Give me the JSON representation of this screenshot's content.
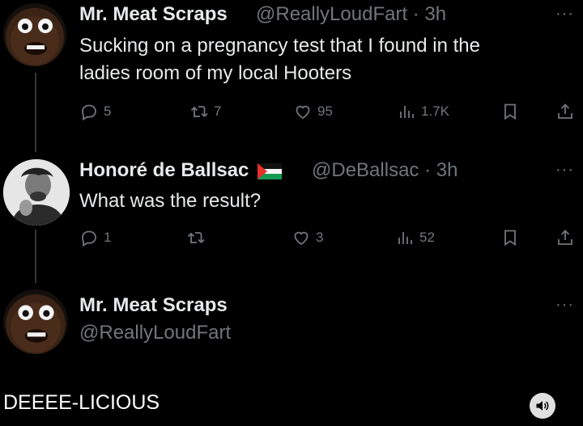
{
  "tweet1": {
    "name": "Mr. Meat Scraps",
    "handle_time": "@ReallyLoudFart · 3h",
    "text_line1": "Sucking on a pregnancy test that I found in the",
    "text_line2": "ladies room of my local Hooters",
    "replies": "5",
    "reposts": "7",
    "likes": "95",
    "views": "1.7K"
  },
  "tweet2": {
    "name": "Honoré de Ballsac",
    "handle_time": "@DeBallsac · 3h",
    "text": "What was the result?",
    "replies": "1",
    "likes": "3",
    "views": "52"
  },
  "tweet3": {
    "name": "Mr. Meat Scraps",
    "handle": "@ReallyLoudFart"
  },
  "caption": "DEEEE-LICIOUS",
  "icons": {
    "more": "···",
    "reply": "reply-icon",
    "repost": "repost-icon",
    "like": "heart-icon",
    "views": "views-icon",
    "bookmark": "bookmark-icon",
    "share": "share-icon",
    "sound": "speaker-icon"
  },
  "colors": {
    "background": "#000000",
    "text": "#e7e9ea",
    "muted": "#71767b"
  }
}
